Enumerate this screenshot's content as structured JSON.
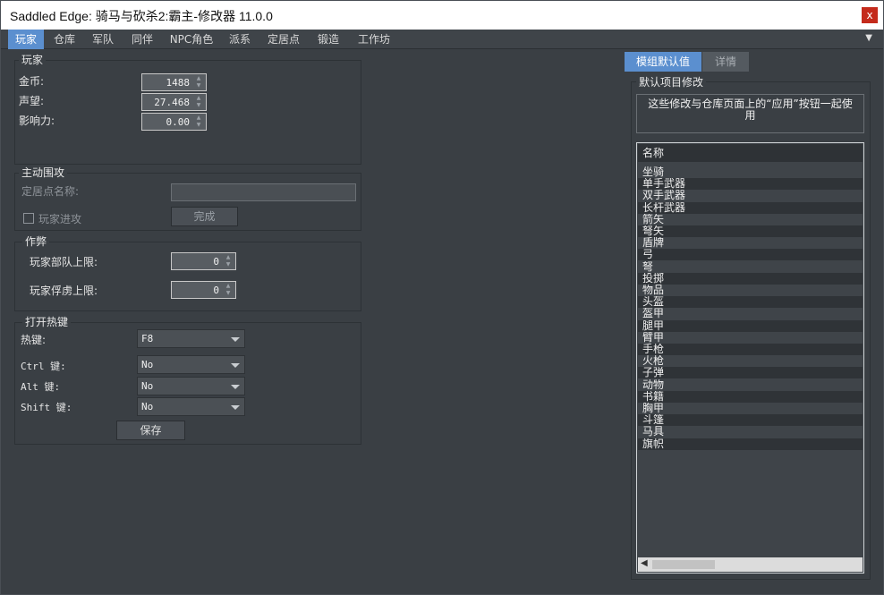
{
  "window": {
    "title": "Saddled Edge: 骑马与砍杀2:霸主-修改器 11.0.0",
    "close_label": "x"
  },
  "tabs": [
    "玩家",
    "仓库",
    "军队",
    "同伴",
    "NPC角色",
    "派系",
    "定居点",
    "锻造",
    "工作坊"
  ],
  "player": {
    "group_title": "玩家",
    "gold_label": "金币:",
    "gold_value": "1488",
    "renown_label": "声望:",
    "renown_value": "27.468",
    "influence_label": "影响力:",
    "influence_value": "0.00"
  },
  "siege": {
    "group_title": "主动围攻",
    "settlement_label": "定居点名称:",
    "settlement_value": "",
    "player_attack_label": "玩家进攻",
    "done_label": "完成"
  },
  "cheats": {
    "group_title": "作弊",
    "party_limit_label": "玩家部队上限:",
    "party_limit_value": "0",
    "prisoner_limit_label": "玩家俘虏上限:",
    "prisoner_limit_value": "0"
  },
  "hotkey": {
    "group_title": "打开热键",
    "hotkey_label": "热键:",
    "hotkey_value": "F8",
    "ctrl_label": "Ctrl 键:",
    "ctrl_value": "No",
    "alt_label": "Alt  键:",
    "alt_value": "No",
    "shift_label": "Shift 键:",
    "shift_value": "No",
    "save_label": "保存"
  },
  "right_panel": {
    "tab_defaults": "模组默认值",
    "tab_details": "详情",
    "section_title": "默认项目修改",
    "note_line1": "这些修改与仓库页面上的“应用”按钮一起使",
    "note_line2": "用",
    "list_header": "名称",
    "items": [
      "坐骑",
      "单手武器",
      "双手武器",
      "长杆武器",
      "箭矢",
      "弩矢",
      "盾牌",
      "弓",
      "弩",
      "投掷",
      "物品",
      "头盔",
      "盔甲",
      "腿甲",
      "臂甲",
      "手枪",
      "火枪",
      "子弹",
      "动物",
      "书籍",
      "胸甲",
      "斗篷",
      "马具",
      "旗帜"
    ]
  },
  "colors": {
    "accent": "#5b8fcf",
    "background": "#3a3f44",
    "close_red": "#c42b1c"
  }
}
